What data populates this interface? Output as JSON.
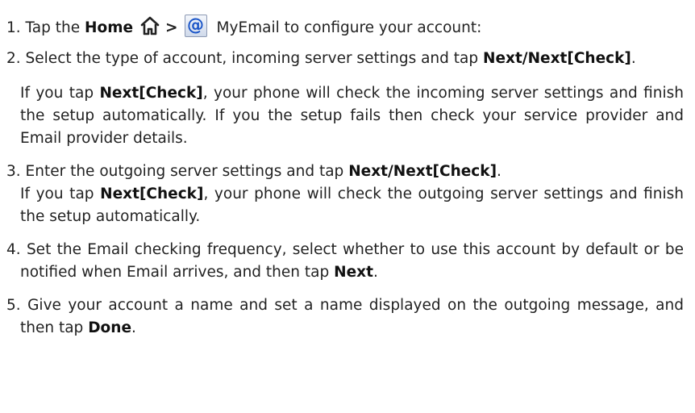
{
  "steps": [
    {
      "num": "1.",
      "text_a": "Tap the",
      "home": "Home",
      "sep": ">",
      "text_b": "MyEmail to configure your account:"
    },
    {
      "num": "2.",
      "text_a": "Select the type of account, incoming server settings and tap",
      "kw": "Next/Next[Check]",
      "end": ".",
      "note_a": "If you tap",
      "note_kw": "Next[Check]",
      "note_b": ", your phone will check the incoming server settings and finish the setup automatically. If you the setup fails then check your service provider and Email provider details."
    },
    {
      "num": "3.",
      "text_a": "Enter the outgoing server settings and tap",
      "kw": "Next/Next[Check]",
      "end": ".",
      "note_a": "If you tap",
      "note_kw": "Next[Check]",
      "note_b": ", your phone will check the outgoing server settings and finish the setup automatically."
    },
    {
      "num": "4.",
      "text_a": "Set the Email checking frequency, select whether to use this account by default or be notified when Email arrives, and then tap",
      "kw": "Next",
      "end": "."
    },
    {
      "num": "5.",
      "text_a": "Give your account a name and set a name displayed on the outgoing message, and then tap",
      "kw": "Done",
      "end": "."
    }
  ],
  "icons": {
    "home": "home-icon",
    "email": "email-app-icon",
    "email_glyph": "@"
  },
  "colors": {
    "text": "#222222",
    "email_icon_glyph": "#1a55c8"
  }
}
